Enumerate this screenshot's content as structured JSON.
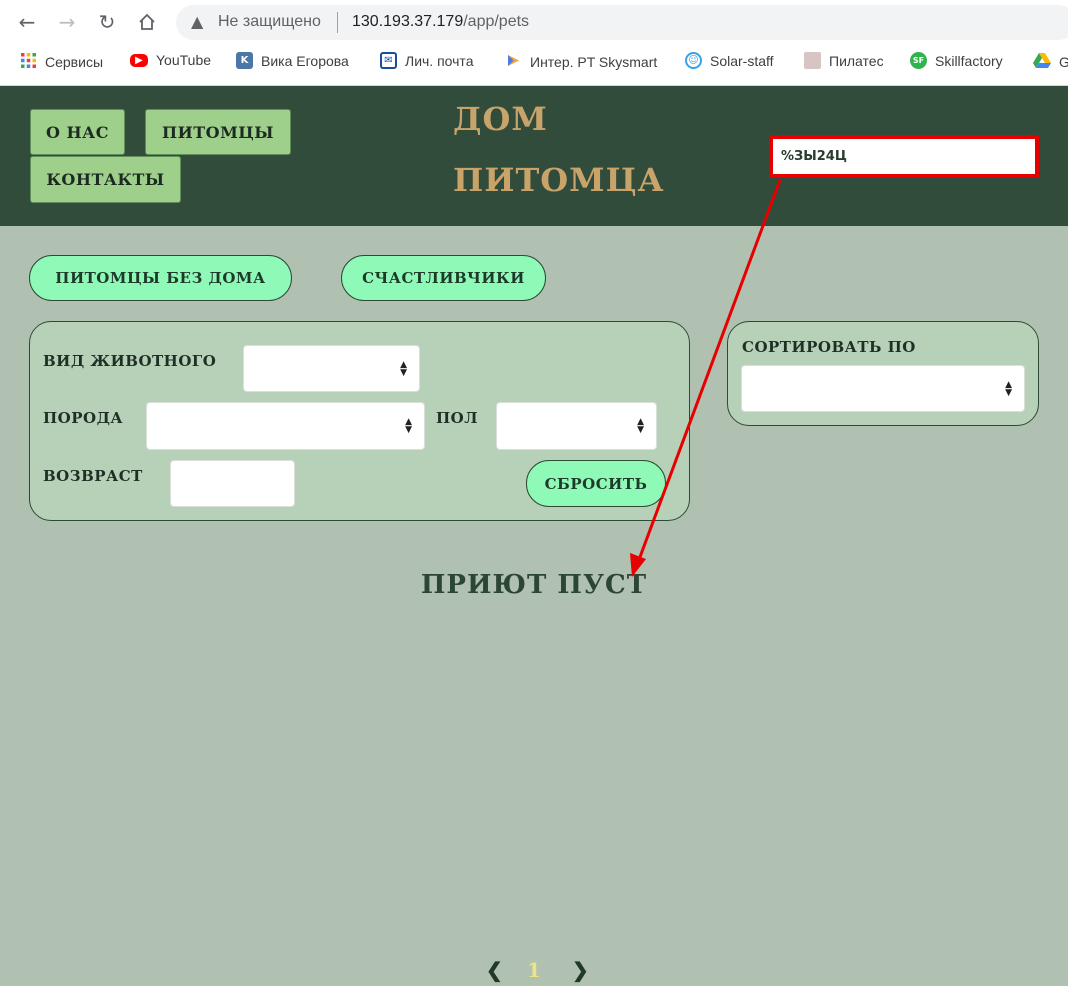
{
  "browser": {
    "insecure_label": "Не защищено",
    "url_host": "130.193.37.179",
    "url_path": "/app/pets",
    "bookmarks": [
      {
        "label": "Сервисы",
        "icon": "apps-grid-icon",
        "color": "#ea4335"
      },
      {
        "label": "YouTube",
        "icon": "youtube-icon",
        "color": "#ff0000"
      },
      {
        "label": "Вика Егорова",
        "icon": "vk-icon",
        "color": "#4a76a8"
      },
      {
        "label": "Лич. почта",
        "icon": "mail-icon",
        "color": "#1a4d9c"
      },
      {
        "label": "Интер. PT Skysmart",
        "icon": "play-icon",
        "color": "#f2a23a"
      },
      {
        "label": "Solar-staff",
        "icon": "solar-icon",
        "color": "#3aa0e8"
      },
      {
        "label": "Пилатес",
        "icon": "pilates-photo-icon",
        "color": "#b48a8a"
      },
      {
        "label": "Skillfactory",
        "icon": "skillfactory-icon",
        "color": "#2fb34a"
      },
      {
        "label": "G",
        "icon": "google-drive-icon",
        "color": "#fbbc04"
      }
    ]
  },
  "header": {
    "nav": {
      "about": "О НАС",
      "pets": "ПИТОМЦЫ",
      "contacts": "КОНТАКТЫ"
    },
    "logo_line1": "ДОМ",
    "logo_line2": "ПИТОМЦА",
    "search_value": "%ЗЫ24Ц"
  },
  "tabs": {
    "homeless": "ПИТОМЦЫ БЕЗ ДОМА",
    "lucky": "СЧАСТЛИВЧИКИ"
  },
  "filters": {
    "animal_type_label": "ВИД ЖИВОТНОГО",
    "breed_label": "ПОРОДА",
    "sex_label": "ПОЛ",
    "age_label": "ВОЗВРАСТ",
    "reset_label": "СБРОСИТЬ"
  },
  "sort": {
    "label": "СОРТИРОВАТЬ ПО"
  },
  "empty_message": "ПРИЮТ ПУСТ",
  "pagination": {
    "prev": "❮",
    "current": "1",
    "next": "❯"
  },
  "colors": {
    "header_bg": "#324c3c",
    "page_bg": "#b1c1b1",
    "logo": "#c8a46a",
    "pill": "#8ffab8",
    "nav_button": "#9ed08b",
    "annotation": "#e60000",
    "page_number": "#e8e58a"
  }
}
